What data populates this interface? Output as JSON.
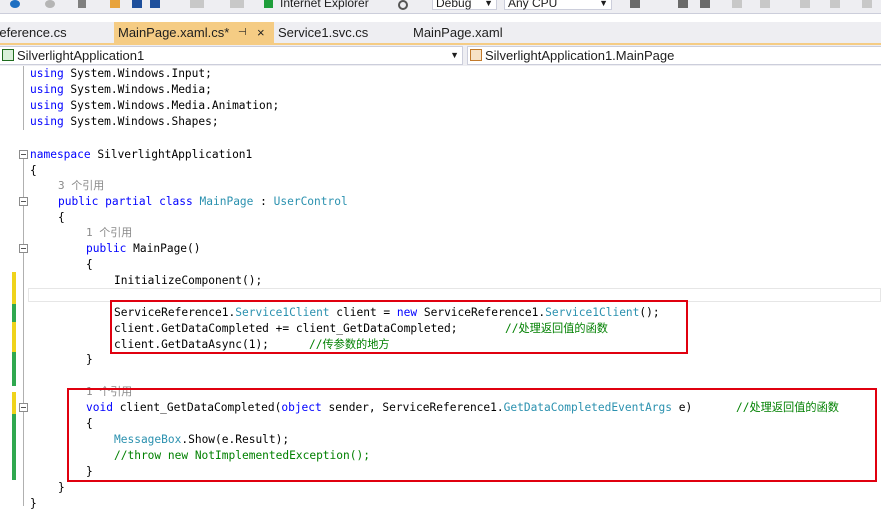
{
  "toolbar": {
    "browser": "Internet Explorer",
    "config": "Debug",
    "platform": "Any CPU"
  },
  "tabs": [
    {
      "label": "Reference.cs"
    },
    {
      "label": "MainPage.xaml.cs*",
      "pin": "⊣",
      "close": "×"
    },
    {
      "label": "Service1.svc.cs"
    },
    {
      "label": "MainPage.xaml"
    }
  ],
  "nav": {
    "project": "SilverlightApplication1",
    "member": "SilverlightApplication1.MainPage"
  },
  "code": {
    "l1": {
      "kw": "using",
      "rest": " System.Windows.Input;"
    },
    "l2": {
      "kw": "using",
      "rest": " System.Windows.Media;"
    },
    "l3": {
      "kw": "using",
      "rest": " System.Windows.Media.Animation;"
    },
    "l4": {
      "kw": "using",
      "rest": " System.Windows.Shapes;"
    },
    "l6": {
      "kw": "namespace",
      "rest": " SilverlightApplication1"
    },
    "l7": "{",
    "ref3": "3 个引用",
    "l8": {
      "kw1": "public",
      "kw2": "partial",
      "kw3": "class",
      "t1": "MainPage",
      "colon": " : ",
      "t2": "UserControl"
    },
    "l9": "{",
    "ref1a": "1 个引用",
    "l10": {
      "kw": "public",
      "rest": " MainPage()"
    },
    "l11": "{",
    "l12": "InitializeComponent();",
    "l14": {
      "a": "ServiceReference1.",
      "t1": "Service1Client",
      "b": " client = ",
      "kw": "new",
      "c": " ServiceReference1.",
      "t2": "Service1Client",
      "d": "();"
    },
    "l15": {
      "code": "client.GetDataCompleted += client_GetDataCompleted;",
      "comment": "//处理返回值的函数"
    },
    "l16": {
      "code": "client.GetDataAsync(1);",
      "comment": "//传参数的地方"
    },
    "l17": "}",
    "ref1b": "1 个引用",
    "l19": {
      "kw1": "void",
      "a": " client_GetDataCompleted(",
      "kw2": "object",
      "b": " sender, ServiceReference1.",
      "t": "GetDataCompletedEventArgs",
      "c": " e)",
      "comment": "//处理返回值的函数"
    },
    "l20": "{",
    "l21": {
      "t": "MessageBox",
      "rest": ".Show(e.Result);"
    },
    "l22": "//throw new NotImplementedException();",
    "l23": "}",
    "l24": "}",
    "l25": "}"
  },
  "colors": {
    "keyword": "#0000ff",
    "type": "#2b91af",
    "comment": "#008000",
    "highlight_box": "#e0000f",
    "active_tab": "#f5cc84"
  }
}
